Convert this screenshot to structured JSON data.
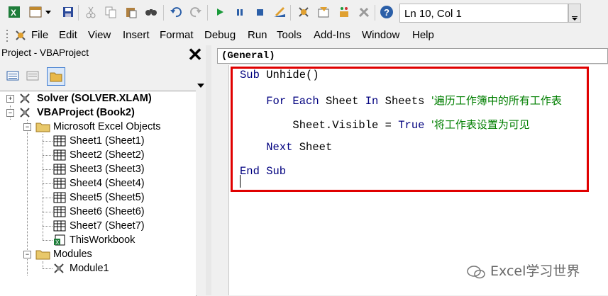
{
  "toolbar": {
    "icons": [
      "excel-view-icon",
      "insert-module-icon",
      "dropdown-arrow-icon",
      "save-icon",
      "cut-icon",
      "copy-icon",
      "paste-icon",
      "find-icon",
      "undo-icon",
      "redo-icon",
      "run-icon",
      "break-icon",
      "reset-icon",
      "design-mode-icon",
      "project-explorer-icon",
      "properties-icon",
      "object-browser-icon",
      "toolbox-icon",
      "help-icon"
    ],
    "status": "Ln 10, Col 1"
  },
  "menu": [
    "File",
    "Edit",
    "View",
    "Insert",
    "Format",
    "Debug",
    "Run",
    "Tools",
    "Add-Ins",
    "Window",
    "Help"
  ],
  "project_panel": {
    "title": "Project - VBAProject",
    "close_glyph": "✕",
    "tree": [
      {
        "label": "Solver (SOLVER.XLAM)",
        "level": 0,
        "bold": true,
        "expander": "+"
      },
      {
        "label": "VBAProject (Book2)",
        "level": 0,
        "bold": true,
        "expander": "−"
      },
      {
        "label": "Microsoft Excel Objects",
        "level": 1,
        "bold": false,
        "expander": "−"
      },
      {
        "label": "Sheet1 (Sheet1)",
        "level": 2
      },
      {
        "label": "Sheet2 (Sheet2)",
        "level": 2
      },
      {
        "label": "Sheet3 (Sheet3)",
        "level": 2
      },
      {
        "label": "Sheet4 (Sheet4)",
        "level": 2
      },
      {
        "label": "Sheet5 (Sheet5)",
        "level": 2
      },
      {
        "label": "Sheet6 (Sheet6)",
        "level": 2
      },
      {
        "label": "Sheet7 (Sheet7)",
        "level": 2
      },
      {
        "label": "ThisWorkbook",
        "level": 2
      },
      {
        "label": "Modules",
        "level": 1,
        "expander": "−"
      },
      {
        "label": "Module1",
        "level": 2
      }
    ]
  },
  "code": {
    "object_dropdown": "(General)",
    "lines": [
      {
        "parts": [
          {
            "t": "Sub ",
            "c": "kw"
          },
          {
            "t": "Unhide()",
            "c": ""
          }
        ]
      },
      {
        "parts": [
          {
            "t": "    "
          },
          {
            "t": "For Each ",
            "c": "kw"
          },
          {
            "t": "Sheet ",
            "c": ""
          },
          {
            "t": "In ",
            "c": "kw"
          },
          {
            "t": "Sheets ",
            "c": ""
          },
          {
            "t": "'遍历工作簿中的所有工作表",
            "c": "cm"
          }
        ]
      },
      {
        "parts": [
          {
            "t": "        Sheet.Visible = "
          },
          {
            "t": "True ",
            "c": "kw"
          },
          {
            "t": "'将工作表设置为可见",
            "c": "cm"
          }
        ]
      },
      {
        "parts": [
          {
            "t": "    "
          },
          {
            "t": "Next ",
            "c": "kw"
          },
          {
            "t": "Sheet",
            "c": ""
          }
        ]
      },
      {
        "parts": [
          {
            "t": "End Sub",
            "c": "kw"
          }
        ]
      }
    ],
    "highlight_color": "#e00000"
  },
  "watermark": "Excel学习世界"
}
